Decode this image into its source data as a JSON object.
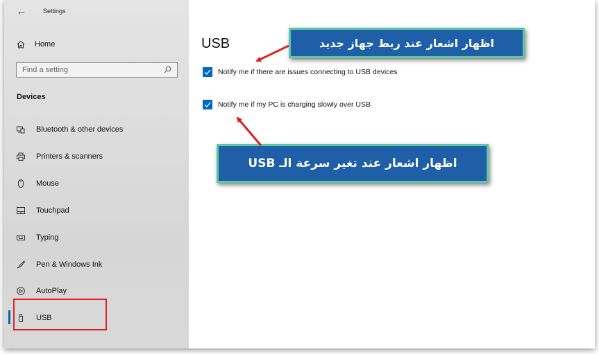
{
  "window": {
    "title": "Settings"
  },
  "sidebar": {
    "home_label": "Home",
    "search_placeholder": "Find a setting",
    "section_title": "Devices",
    "items": [
      {
        "label": "Bluetooth & other devices",
        "icon": "bluetooth-devices-icon"
      },
      {
        "label": "Printers & scanners",
        "icon": "printer-icon"
      },
      {
        "label": "Mouse",
        "icon": "mouse-icon"
      },
      {
        "label": "Touchpad",
        "icon": "touchpad-icon"
      },
      {
        "label": "Typing",
        "icon": "keyboard-icon"
      },
      {
        "label": "Pen & Windows Ink",
        "icon": "pen-icon"
      },
      {
        "label": "AutoPlay",
        "icon": "autoplay-icon"
      },
      {
        "label": "USB",
        "icon": "usb-icon",
        "selected": true
      }
    ]
  },
  "main": {
    "title": "USB",
    "options": [
      {
        "label": "Notify me if there are issues connecting to USB devices",
        "checked": true
      },
      {
        "label": "Notify me if my PC is charging slowly over USB",
        "checked": true
      }
    ]
  },
  "annotations": {
    "callout_top": "اظهار اشعار عند ربط جهاز جديد",
    "callout_bottom": "اظهار اشعار عند تغير سرعة الـ USB"
  },
  "colors": {
    "accent": "#0067c0",
    "callout_fill": "#1e5fa8",
    "callout_border": "#5cc7a5",
    "highlight_red": "#e02020"
  }
}
